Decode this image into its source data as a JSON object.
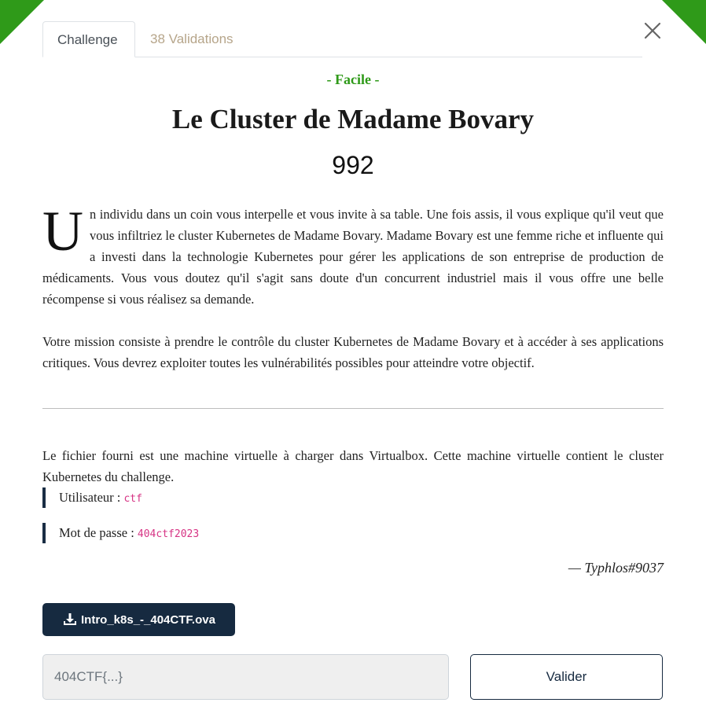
{
  "tabs": {
    "challenge": "Challenge",
    "validations": "38 Validations"
  },
  "challenge": {
    "difficulty": "- Facile -",
    "title": "Le Cluster de Madame Bovary",
    "points": "992",
    "intro_dropcap": "U",
    "intro_rest": "n individu dans un coin vous interpelle et vous invite à sa table. Une fois assis, il vous explique qu'il veut que vous infiltriez le cluster Kubernetes de Madame Bovary. Madame Bovary est une femme riche et influente qui a investi dans la technologie Kubernetes pour gérer les applications de son entreprise de production de médicaments. Vous vous doutez qu'il s'agit sans doute d'un concurrent industriel mais il vous offre une belle récompense si vous réalisez sa demande.",
    "mission": "Votre mission consiste à prendre le contrôle du cluster Kubernetes de Madame Bovary et à accéder à ses applications critiques. Vous devrez exploiter toutes les vulnérabilités possibles pour atteindre votre objectif.",
    "file_note": "Le fichier fourni est une machine virtuelle à charger dans Virtualbox. Cette machine virtuelle contient le cluster Kubernetes du challenge.",
    "user_label": "Utilisateur : ",
    "user_value": "ctf",
    "password_label": "Mot de passe : ",
    "password_value": "404ctf2023",
    "author": "— Typhlos#9037"
  },
  "download": {
    "label": "Intro_k8s_-_404CTF.ova",
    "icon": "download-icon"
  },
  "flag_form": {
    "placeholder": "404CTF{...}",
    "value": "",
    "submit_label": "Valider"
  },
  "colors": {
    "accent_green": "#2f9a19",
    "navy": "#162a40",
    "tab_inactive": "#b6a58a",
    "code_pink": "#d63384"
  }
}
